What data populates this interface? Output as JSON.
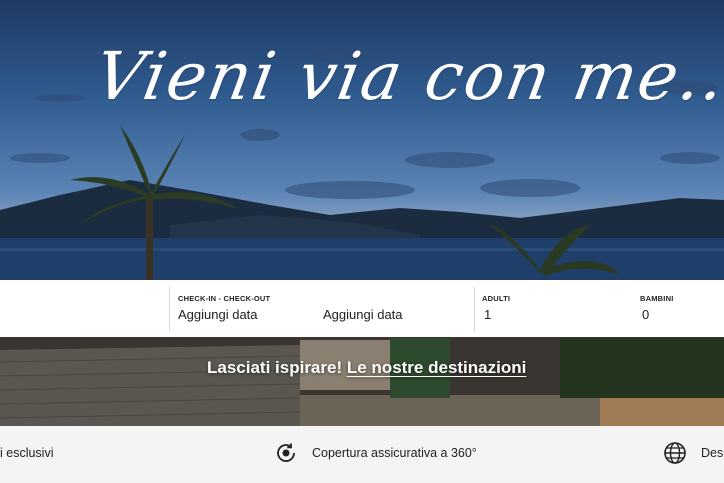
{
  "hero": {
    "title": "Vieni via con me.."
  },
  "search": {
    "checkin_checkout_label": "CHECK-IN - CHECK-OUT",
    "checkin_value": "Aggiungi  data",
    "checkout_value": "Aggiungi  data",
    "adults_label": "ADULTI",
    "adults_value": "1",
    "children_label": "BAMBINI",
    "children_value": "0"
  },
  "inspire": {
    "text": "Lasciati ispirare!",
    "link": "Le nostre destinazioni"
  },
  "features": [
    {
      "text": "i esclusivi",
      "icon": "none"
    },
    {
      "text": "Copertura assicurativa a 360°",
      "icon": "refresh-shield-icon"
    },
    {
      "text": "Des",
      "icon": "globe-icon"
    }
  ],
  "colors": {
    "sky_top": "#1f3a63",
    "sunset": "#f0b896",
    "sea": "#274266",
    "panel": "#ffffff",
    "strip": "#f4f4f4"
  }
}
